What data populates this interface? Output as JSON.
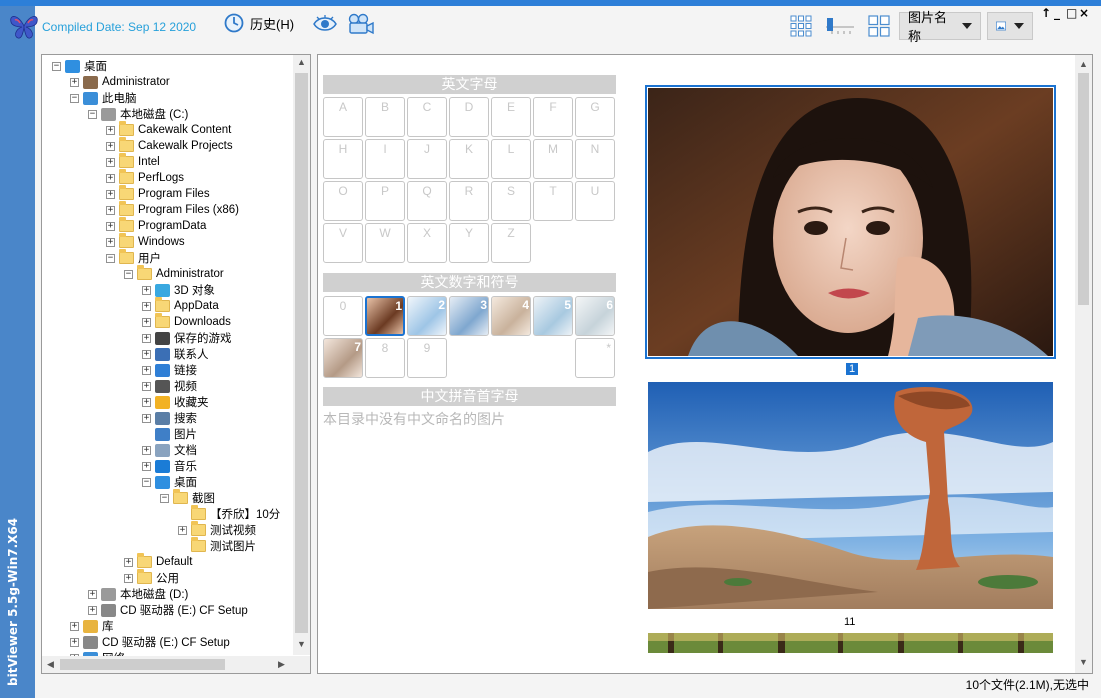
{
  "app": {
    "compiled_date": "Compiled Date: Sep 12 2020",
    "vertical_title": "bitViewer 5.5g-Win7.X64",
    "history_label": "历史(H)",
    "sort_dropdown": "图片名称",
    "window_controls": [
      "↑",
      "_",
      "□",
      "×"
    ]
  },
  "tree": {
    "items": [
      {
        "label": "桌面",
        "level": 0,
        "pm": "-",
        "icon": "desktop-icon"
      },
      {
        "label": "Administrator",
        "level": 1,
        "pm": "+",
        "icon": "user-icon"
      },
      {
        "label": "此电脑",
        "level": 1,
        "pm": "-",
        "icon": "computer-icon"
      },
      {
        "label": "本地磁盘 (C:)",
        "level": 2,
        "pm": "-",
        "icon": "drive-icon"
      },
      {
        "label": "Cakewalk Content",
        "level": 3,
        "pm": "+",
        "icon": "folder-icon"
      },
      {
        "label": "Cakewalk Projects",
        "level": 3,
        "pm": "+",
        "icon": "folder-icon"
      },
      {
        "label": "Intel",
        "level": 3,
        "pm": "+",
        "icon": "folder-icon"
      },
      {
        "label": "PerfLogs",
        "level": 3,
        "pm": "+",
        "icon": "folder-icon"
      },
      {
        "label": "Program Files",
        "level": 3,
        "pm": "+",
        "icon": "folder-icon"
      },
      {
        "label": "Program Files (x86)",
        "level": 3,
        "pm": "+",
        "icon": "folder-icon"
      },
      {
        "label": "ProgramData",
        "level": 3,
        "pm": "+",
        "icon": "folder-icon"
      },
      {
        "label": "Windows",
        "level": 3,
        "pm": "+",
        "icon": "folder-icon"
      },
      {
        "label": "用户",
        "level": 3,
        "pm": "-",
        "icon": "folder-icon"
      },
      {
        "label": "Administrator",
        "level": 4,
        "pm": "-",
        "icon": "folder-icon"
      },
      {
        "label": "3D 对象",
        "level": 5,
        "pm": "+",
        "icon": "cube-icon"
      },
      {
        "label": "AppData",
        "level": 5,
        "pm": "+",
        "icon": "folder-icon"
      },
      {
        "label": "Downloads",
        "level": 5,
        "pm": "+",
        "icon": "folder-icon"
      },
      {
        "label": "保存的游戏",
        "level": 5,
        "pm": "+",
        "icon": "game-icon"
      },
      {
        "label": "联系人",
        "level": 5,
        "pm": "+",
        "icon": "contacts-icon"
      },
      {
        "label": "链接",
        "level": 5,
        "pm": "+",
        "icon": "link-icon"
      },
      {
        "label": "视频",
        "level": 5,
        "pm": "+",
        "icon": "video-icon"
      },
      {
        "label": "收藏夹",
        "level": 5,
        "pm": "+",
        "icon": "star-icon"
      },
      {
        "label": "搜索",
        "level": 5,
        "pm": "+",
        "icon": "search-icon"
      },
      {
        "label": "图片",
        "level": 5,
        "pm": "",
        "icon": "picture-icon"
      },
      {
        "label": "文档",
        "level": 5,
        "pm": "+",
        "icon": "document-icon"
      },
      {
        "label": "音乐",
        "level": 5,
        "pm": "+",
        "icon": "music-icon"
      },
      {
        "label": "桌面",
        "level": 5,
        "pm": "-",
        "icon": "desktop-icon"
      },
      {
        "label": "截图",
        "level": 6,
        "pm": "-",
        "icon": "folder-icon"
      },
      {
        "label": "【乔欣】10分",
        "level": 7,
        "pm": "",
        "icon": "folder-icon"
      },
      {
        "label": "测试视频",
        "level": 7,
        "pm": "+",
        "icon": "folder-icon"
      },
      {
        "label": "测试图片",
        "level": 7,
        "pm": "",
        "icon": "folder-icon"
      },
      {
        "label": "Default",
        "level": 4,
        "pm": "+",
        "icon": "folder-icon"
      },
      {
        "label": "公用",
        "level": 4,
        "pm": "+",
        "icon": "folder-icon"
      },
      {
        "label": "本地磁盘 (D:)",
        "level": 2,
        "pm": "+",
        "icon": "drive-icon"
      },
      {
        "label": "CD 驱动器 (E:) CF Setup",
        "level": 2,
        "pm": "+",
        "icon": "cd-icon"
      },
      {
        "label": "库",
        "level": 1,
        "pm": "+",
        "icon": "library-icon"
      },
      {
        "label": "CD 驱动器 (E:) CF Setup",
        "level": 1,
        "pm": "+",
        "icon": "cd-icon"
      },
      {
        "label": "网络",
        "level": 1,
        "pm": "+",
        "icon": "network-icon"
      }
    ]
  },
  "index": {
    "letters_title": "英文字母",
    "letters": [
      "A",
      "B",
      "C",
      "D",
      "E",
      "F",
      "G",
      "H",
      "I",
      "J",
      "K",
      "L",
      "M",
      "N",
      "O",
      "P",
      "Q",
      "R",
      "S",
      "T",
      "U",
      "V",
      "W",
      "X",
      "Y",
      "Z"
    ],
    "digits_title": "英文数字和符号",
    "digits": [
      {
        "label": "0",
        "thumb": false
      },
      {
        "label": "1",
        "thumb": true,
        "selected": true
      },
      {
        "label": "2",
        "thumb": true
      },
      {
        "label": "3",
        "thumb": true
      },
      {
        "label": "4",
        "thumb": true
      },
      {
        "label": "5",
        "thumb": true
      },
      {
        "label": "6",
        "thumb": true
      },
      {
        "label": "7",
        "thumb": true
      },
      {
        "label": "8",
        "thumb": false
      },
      {
        "label": "9",
        "thumb": false
      },
      {
        "label": "*",
        "thumb": false
      }
    ],
    "pinyin_title": "中文拼音首字母",
    "pinyin_empty": "本目录中没有中文命名的图片"
  },
  "photos": [
    {
      "caption": "1",
      "subject": "portrait-photo"
    },
    {
      "caption": "11",
      "subject": "rock-landscape-photo"
    }
  ],
  "status": "10个文件(2.1M),无选中",
  "colors": {
    "accent": "#1b73d1",
    "strip": "#4a86c9",
    "compiled": "#26a0da"
  }
}
